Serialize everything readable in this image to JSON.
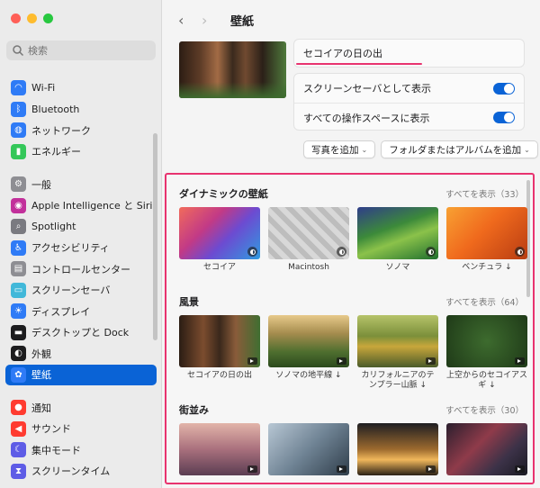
{
  "sidebar": {
    "search_placeholder": "検索",
    "groups": [
      [
        {
          "label": "Wi-Fi",
          "icon": "wifi-icon",
          "color": "#2f7bf6"
        },
        {
          "label": "Bluetooth",
          "icon": "bluetooth-icon",
          "color": "#2f7bf6"
        },
        {
          "label": "ネットワーク",
          "icon": "network-globe-icon",
          "color": "#2f7bf6"
        },
        {
          "label": "エネルギー",
          "icon": "battery-icon",
          "color": "#34c759"
        }
      ],
      [
        {
          "label": "一般",
          "icon": "gear-icon",
          "color": "#8e8e93"
        },
        {
          "label": "Apple Intelligence と Siri",
          "icon": "siri-icon",
          "color": "#c2309b"
        },
        {
          "label": "Spotlight",
          "icon": "magnifier-icon",
          "color": "#7a7a80"
        },
        {
          "label": "アクセシビリティ",
          "icon": "accessibility-icon",
          "color": "#2f7bf6"
        },
        {
          "label": "コントロールセンター",
          "icon": "control-center-icon",
          "color": "#8e8e93"
        },
        {
          "label": "スクリーンセーバ",
          "icon": "screensaver-icon",
          "color": "#41b8d9"
        },
        {
          "label": "ディスプレイ",
          "icon": "sun-icon",
          "color": "#2f7bf6"
        },
        {
          "label": "デスクトップと Dock",
          "icon": "dock-icon",
          "color": "#1c1c1e"
        },
        {
          "label": "外観",
          "icon": "appearance-icon",
          "color": "#1c1c1e"
        },
        {
          "label": "壁紙",
          "icon": "wallpaper-icon",
          "color": "#2f7bf6"
        }
      ],
      [
        {
          "label": "通知",
          "icon": "bell-icon",
          "color": "#ff3b30"
        },
        {
          "label": "サウンド",
          "icon": "speaker-icon",
          "color": "#ff3b30"
        },
        {
          "label": "集中モード",
          "icon": "moon-icon",
          "color": "#5e5ce6"
        },
        {
          "label": "スクリーンタイム",
          "icon": "hourglass-icon",
          "color": "#5e5ce6"
        }
      ]
    ],
    "active": "壁紙"
  },
  "topbar": {
    "title": "壁紙"
  },
  "current": {
    "name": "セコイアの日の出"
  },
  "options": [
    {
      "label": "スクリーンセーバとして表示",
      "on": true
    },
    {
      "label": "すべての操作スペースに表示",
      "on": true
    }
  ],
  "buttons": {
    "add_photo": "写真を追加",
    "add_folder": "フォルダまたはアルバムを追加"
  },
  "sections": [
    {
      "title": "ダイナミックの壁紙",
      "more": "すべてを表示（33）",
      "items": [
        {
          "caption": "セコイア",
          "kind": "dynamic"
        },
        {
          "caption": "Macintosh",
          "kind": "dynamic"
        },
        {
          "caption": "ソノマ",
          "kind": "dynamic"
        },
        {
          "caption": "ベンチュラ ↓",
          "kind": "dynamic"
        }
      ]
    },
    {
      "title": "風景",
      "more": "すべてを表示（64）",
      "items": [
        {
          "caption": "セコイアの日の出",
          "kind": "video"
        },
        {
          "caption": "ソノマの地平線 ↓",
          "kind": "video"
        },
        {
          "caption": "カリフォルニアのテンプラー山脈 ↓",
          "kind": "video"
        },
        {
          "caption": "上空からのセコイアスギ ↓",
          "kind": "video"
        }
      ]
    },
    {
      "title": "街並み",
      "more": "すべてを表示（30）",
      "items": [
        {
          "caption": "",
          "kind": "video"
        },
        {
          "caption": "",
          "kind": "video"
        },
        {
          "caption": "",
          "kind": "video"
        },
        {
          "caption": "",
          "kind": "video"
        }
      ]
    }
  ],
  "colors": {
    "accent": "#0a63d6",
    "highlight": "#e8336f"
  }
}
